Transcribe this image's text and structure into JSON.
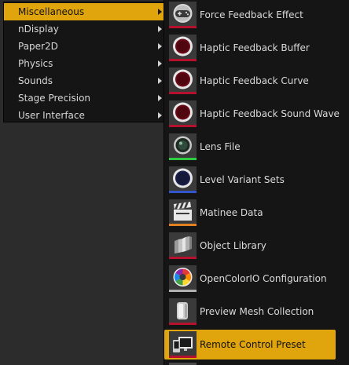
{
  "categories": [
    {
      "label": "Miscellaneous",
      "selected": true,
      "has_submenu": true
    },
    {
      "label": "nDisplay",
      "selected": false,
      "has_submenu": true
    },
    {
      "label": "Paper2D",
      "selected": false,
      "has_submenu": true
    },
    {
      "label": "Physics",
      "selected": false,
      "has_submenu": true
    },
    {
      "label": "Sounds",
      "selected": false,
      "has_submenu": true
    },
    {
      "label": "Stage Precision",
      "selected": false,
      "has_submenu": true
    },
    {
      "label": "User Interface",
      "selected": false,
      "has_submenu": true
    }
  ],
  "assets": [
    {
      "label": "Force Feedback Effect",
      "icon": "gamepad-icon",
      "accent": "#b5102e",
      "selected": false
    },
    {
      "label": "Haptic Feedback Buffer",
      "icon": "haptic-buffer-icon",
      "accent": "#b5102e",
      "selected": false
    },
    {
      "label": "Haptic Feedback Curve",
      "icon": "haptic-curve-icon",
      "accent": "#b5102e",
      "selected": false
    },
    {
      "label": "Haptic Feedback Sound Wave",
      "icon": "haptic-soundwave-icon",
      "accent": "#b5102e",
      "selected": false
    },
    {
      "label": "Lens File",
      "icon": "lens-icon",
      "accent": "#2ecc40",
      "selected": false
    },
    {
      "label": "Level Variant Sets",
      "icon": "level-variant-icon",
      "accent": "#3355cc",
      "selected": false
    },
    {
      "label": "Matinee Data",
      "icon": "clapperboard-icon",
      "accent": "#e08020",
      "selected": false
    },
    {
      "label": "Object Library",
      "icon": "object-library-icon",
      "accent": "#b5102e",
      "selected": false
    },
    {
      "label": "OpenColorIO Configuration",
      "icon": "color-wheel-icon",
      "accent": "#b0b0b0",
      "selected": false
    },
    {
      "label": "Preview Mesh Collection",
      "icon": "mesh-collection-icon",
      "accent": "#b5102e",
      "selected": false
    },
    {
      "label": "Remote Control Preset",
      "icon": "remote-control-icon",
      "accent": "#b5102e",
      "selected": true
    }
  ],
  "colors": {
    "menu_bg": "#151515",
    "highlight": "#e0a40c",
    "desktop_bg": "#2c2c2c"
  }
}
